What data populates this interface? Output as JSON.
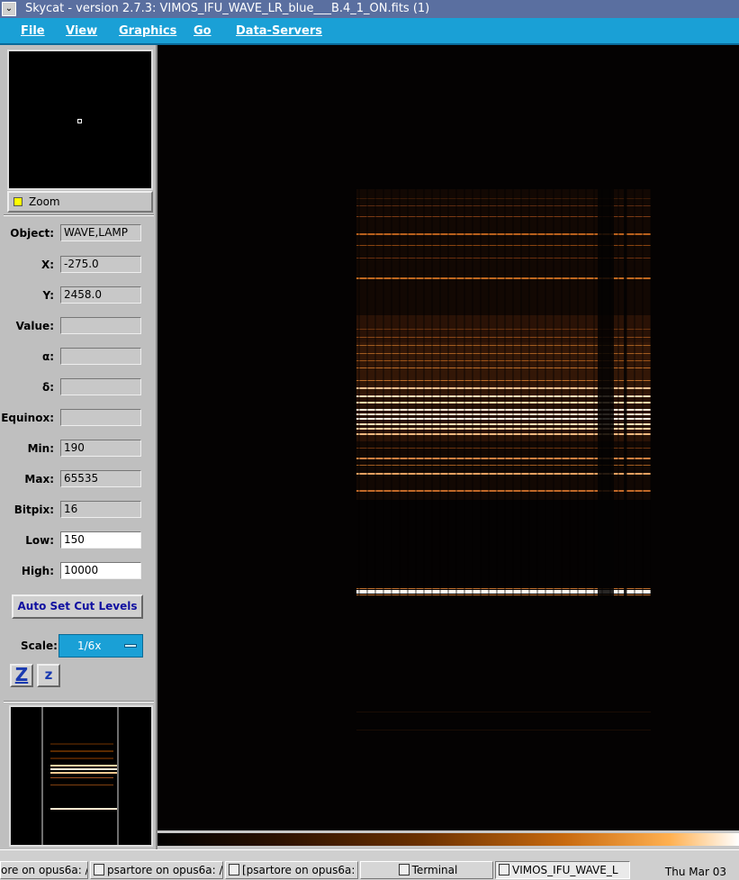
{
  "window": {
    "title": "Skycat - version 2.7.3: VIMOS_IFU_WAVE_LR_blue___B.4_1_ON.fits (1)",
    "menu_glyph": "⌄"
  },
  "menu": [
    "File",
    "View",
    "Graphics",
    "Go",
    "Data-Servers"
  ],
  "zoom": {
    "label": "Zoom"
  },
  "fields": [
    {
      "label": "Object:",
      "value": "WAVE,LAMP"
    },
    {
      "label": "X:",
      "value": "-275.0"
    },
    {
      "label": "Y:",
      "value": "2458.0"
    },
    {
      "label": "Value:",
      "value": ""
    },
    {
      "label": "α:",
      "value": ""
    },
    {
      "label": "δ:",
      "value": ""
    },
    {
      "label": "Equinox:",
      "value": ""
    },
    {
      "label": "Min:",
      "value": "190"
    },
    {
      "label": "Max:",
      "value": "65535"
    },
    {
      "label": "Bitpix:",
      "value": "16"
    },
    {
      "label": "Low:",
      "value": "150"
    },
    {
      "label": "High:",
      "value": "10000"
    }
  ],
  "auto_cut": "Auto Set Cut Levels",
  "scale": {
    "label": "Scale:",
    "value": "1/6x"
  },
  "zoom_buttons": [
    "Z",
    "z"
  ],
  "taskbar": {
    "tasks": [
      "ore on opus6a: /",
      "psartore on opus6a: /h",
      "[psartore on opus6a: /",
      "Terminal",
      "VIMOS_IFU_WAVE_L"
    ],
    "clock": "Thu Mar 03"
  },
  "colors": {
    "menubar": "#1aa0d6",
    "titlebar": "#5a6fa0",
    "accent_text": "#1010a0"
  }
}
